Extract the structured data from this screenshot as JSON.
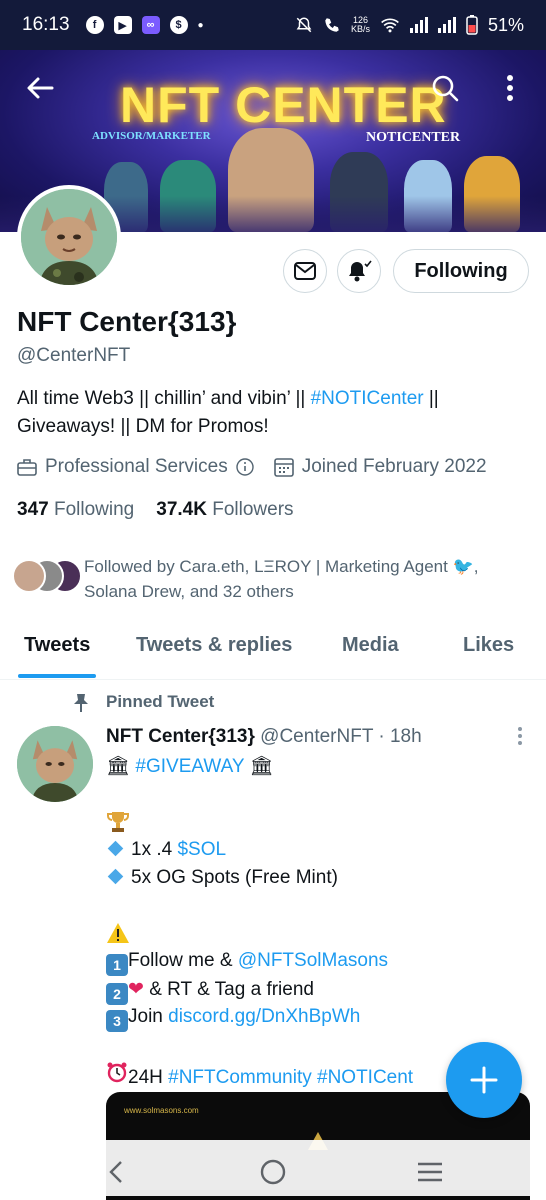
{
  "status": {
    "time": "16:13",
    "net_speed_value": "126",
    "net_speed_unit": "KB/s",
    "battery": "51%"
  },
  "banner": {
    "title": "NFT CENTER",
    "left_caption": "ADVISOR/MARKETER",
    "right_caption": "NOTICENTER"
  },
  "profile": {
    "name": "NFT Center{313}",
    "handle": "@CenterNFT",
    "bio_part1": "All time Web3 || chillin’ and vibin’ || ",
    "bio_link": "#NOTICenter",
    "bio_part2": " || Giveaways! || DM for Promos!",
    "category": "Professional Services",
    "joined": "Joined February 2022",
    "following_count": "347",
    "following_label": "Following",
    "followers_count": "37.4K",
    "followers_label": "Followers",
    "followed_by": "Followed by Cara.eth, LΞROY | Marketing Agent 🐦, Solana Drew, and 32 others",
    "follow_button": "Following"
  },
  "tabs": [
    {
      "label": "Tweets"
    },
    {
      "label": "Tweets & replies"
    },
    {
      "label": "Media"
    },
    {
      "label": "Likes"
    }
  ],
  "tweet": {
    "pinned_label": "Pinned Tweet",
    "author_name": "NFT Center{313}",
    "author_meta": "@CenterNFT · 18h",
    "giveaway_tag": "#GIVEAWAY",
    "line_sol_prefix": "1x .4 ",
    "line_sol_link": "$SOL",
    "line_spots": "5x OG Spots (Free Mint)",
    "step1_text": "Follow me & ",
    "step1_link": "@NFTSolMasons",
    "step2_text": " & RT & Tag a friend",
    "step3_text": "Join ",
    "step3_link": "discord.gg/DnXhBpWh",
    "timer_text": "24H ",
    "timer_link": "#NFTCommunity #NOTICent",
    "media_url": "www.solmasons.com",
    "emoji_1": "1",
    "emoji_2": "2",
    "emoji_3": "3"
  },
  "icons": {
    "back": "back-arrow-icon",
    "search": "search-icon",
    "more": "more-vertical-icon",
    "message": "envelope-icon",
    "notifications": "bell-icon",
    "compose": "plus-icon"
  },
  "colors": {
    "accent": "#1d9bf0",
    "banner_bg": "#1c1665",
    "title_glow": "#ffe95a"
  }
}
